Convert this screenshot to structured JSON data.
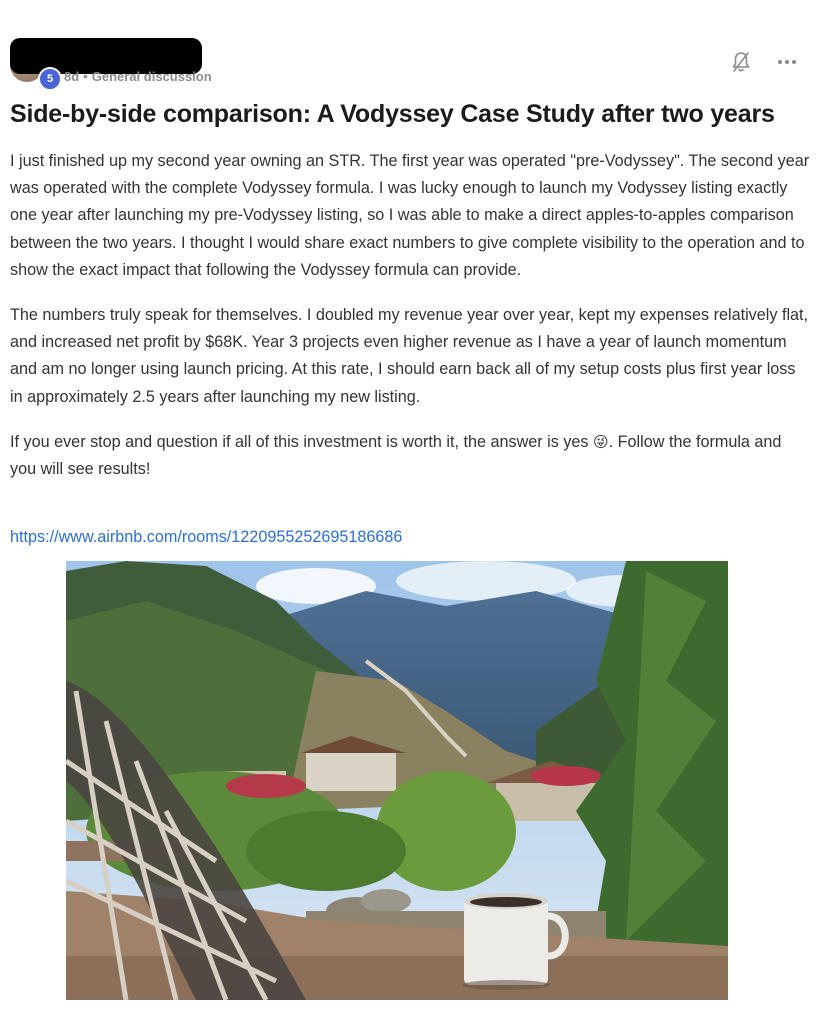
{
  "post": {
    "meta": {
      "level_badge": "5",
      "age": "8d",
      "separator": "•",
      "category": "General discussion"
    },
    "title": "Side-by-side comparison: A Vodyssey Case Study after two years",
    "paragraphs": [
      "I just finished up my second year owning an STR. The first year was operated \"pre-Vodyssey\". The second year was operated with the complete Vodyssey formula. I was lucky enough to launch my Vodyssey listing exactly one year after launching my pre-Vodyssey listing, so I was able to make a direct apples-to-apples comparison between the two years. I thought I would share exact numbers to give complete visibility to the operation and to show the exact impact that following the Vodyssey formula can provide.",
      "The numbers truly speak for themselves. I doubled my revenue year over year, kept my expenses relatively flat, and increased net profit by $68K. Year 3 projects even higher revenue as I have a year of launch momentum and am no longer using launch pricing. At this rate, I should earn back all of my setup costs plus first year loss in approximately 2.5 years after launching my new listing."
    ],
    "closing": {
      "text_before_emoji": "If you ever stop and question if all of this investment is worth it, the answer is yes",
      "emoji": "😜",
      "text_after_emoji": ". Follow the formula and you will see results!"
    },
    "link": "https://www.airbnb.com/rooms/1220955252695186686"
  },
  "icons": {
    "notification": "bell-off-icon",
    "more": "more-options-icon"
  },
  "colors": {
    "link": "#2d6fd6",
    "badge": "#4a63d6",
    "meta": "#8c8c8c"
  }
}
